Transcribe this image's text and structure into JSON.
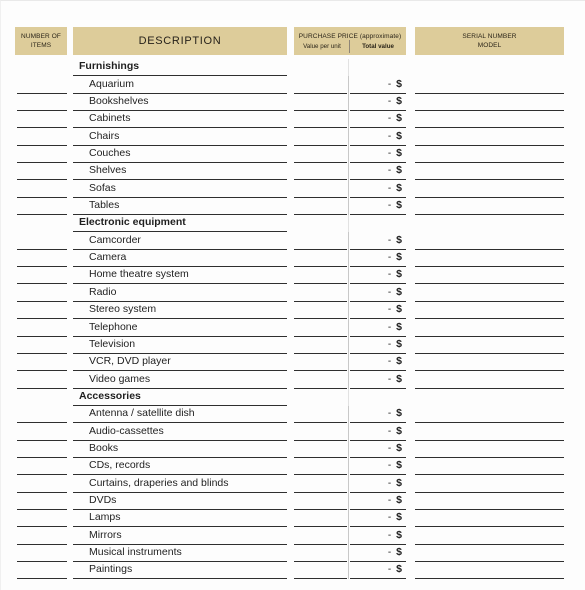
{
  "header": {
    "number_of_items": {
      "line1": "NUMBER OF",
      "line2": "ITEMS"
    },
    "description": "DESCRIPTION",
    "purchase_price": {
      "title": "PURCHASE PRICE (approximate)",
      "value_per_unit": "Value per unit",
      "total_value": "Total value"
    },
    "serial": {
      "line1": "SERIAL NUMBER",
      "line2": "MODEL"
    }
  },
  "cell_values": {
    "dash": "-",
    "currency": "$"
  },
  "colors": {
    "header_background": "#ddcc9a",
    "rule": "#2f2f2f",
    "text": "#1f1f1f"
  },
  "rows": [
    {
      "type": "section",
      "label": "Furnishings"
    },
    {
      "type": "item",
      "label": "Aquarium"
    },
    {
      "type": "item",
      "label": "Bookshelves"
    },
    {
      "type": "item",
      "label": "Cabinets"
    },
    {
      "type": "item",
      "label": "Chairs"
    },
    {
      "type": "item",
      "label": "Couches"
    },
    {
      "type": "item",
      "label": "Shelves"
    },
    {
      "type": "item",
      "label": "Sofas"
    },
    {
      "type": "item",
      "label": "Tables"
    },
    {
      "type": "section",
      "label": "Electronic equipment"
    },
    {
      "type": "item",
      "label": "Camcorder"
    },
    {
      "type": "item",
      "label": "Camera"
    },
    {
      "type": "item",
      "label": "Home theatre system"
    },
    {
      "type": "item",
      "label": "Radio"
    },
    {
      "type": "item",
      "label": "Stereo system"
    },
    {
      "type": "item",
      "label": "Telephone"
    },
    {
      "type": "item",
      "label": "Television"
    },
    {
      "type": "item",
      "label": "VCR, DVD player"
    },
    {
      "type": "item",
      "label": "Video games"
    },
    {
      "type": "section",
      "label": "Accessories"
    },
    {
      "type": "item",
      "label": "Antenna / satellite dish"
    },
    {
      "type": "item",
      "label": "Audio-cassettes"
    },
    {
      "type": "item",
      "label": "Books"
    },
    {
      "type": "item",
      "label": "CDs, records"
    },
    {
      "type": "item",
      "label": "Curtains, draperies and blinds"
    },
    {
      "type": "item",
      "label": "DVDs"
    },
    {
      "type": "item",
      "label": "Lamps"
    },
    {
      "type": "item",
      "label": "Mirrors"
    },
    {
      "type": "item",
      "label": "Musical instruments"
    },
    {
      "type": "item",
      "label": "Paintings"
    }
  ]
}
